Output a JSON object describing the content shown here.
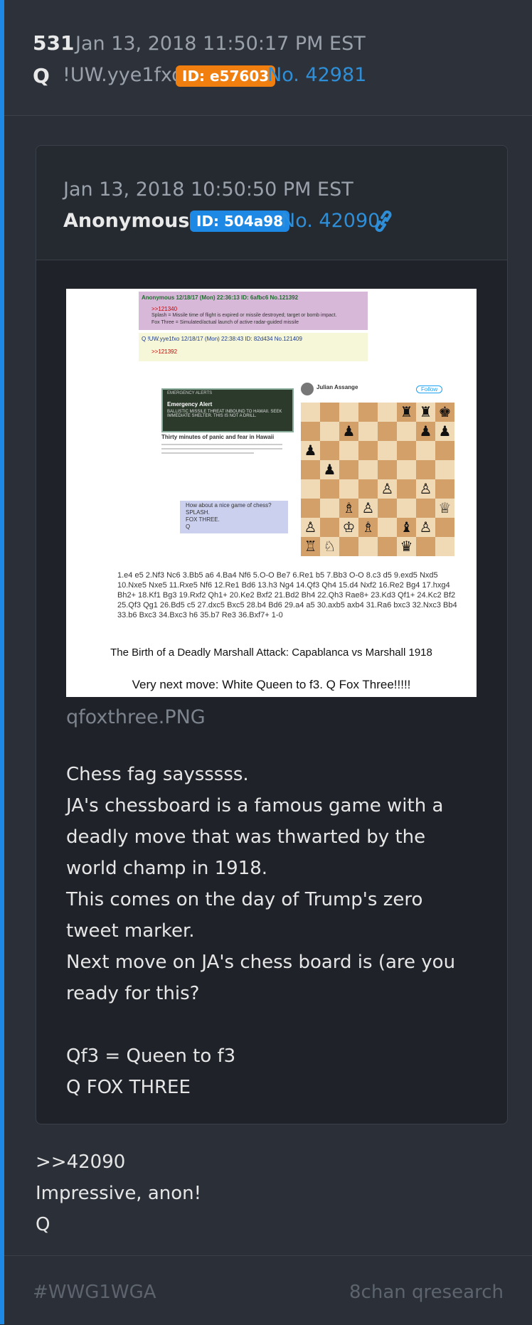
{
  "post": {
    "number": "531",
    "timestamp": "Jan 13, 2018 11:50:17 PM EST",
    "author": "Q",
    "tripcode": "!UW.yye1fxo",
    "id_badge": "ID: e57603",
    "post_no": "No. 42981",
    "reply_lines": [
      ">>42090",
      "Impressive, anon!",
      "Q"
    ]
  },
  "quoted": {
    "timestamp": "Jan 13, 2018 10:50:50 PM EST",
    "author": "Anonymous",
    "id_badge": "ID: 504a98",
    "post_no": "No. 42090",
    "link_icon": "link-icon",
    "image_filename": "qfoxthree.PNG",
    "body_lines": [
      "Chess fag saysssss.",
      "JA's chessboard is a famous game with a deadly move that was thwarted by the world champ in 1918.",
      "This comes on the day of Trump's zero tweet marker.",
      "Next move on JA's chess board is (are you ready for this?",
      "",
      "Qf3 = Queen to f3",
      "Q FOX THREE"
    ]
  },
  "image": {
    "tweet1_header": "Anonymous 12/18/17 (Mon) 22:36:13 ID: 6afbc6 No.121392",
    "tweet1_ref": ">>121340",
    "tweet1_line1": "Splash = Missile time of flight is expired or missile destroyed; target or bomb impact.",
    "tweet1_line2": "Fox Three = Simulated/actual launch of active radar-guided missile",
    "tweet2_header": "Q !UW.yye1fxo 12/18/17 (Mon) 22:38:43 ID: 82d434 No.121409",
    "tweet2_ref": ">>121392",
    "alert_title": "EMERGENCY ALERTS",
    "alert_heading": "Emergency Alert",
    "alert_text": "BALLISTIC MISSILE THREAT INBOUND TO HAWAII. SEEK IMMEDIATE SHELTER. THIS IS NOT A DRILL.",
    "hawaii_title": "Thirty minutes of panic and fear in Hawaii",
    "chess_q_lines": [
      "How about a nice game of chess?",
      "SPLASH.",
      "FOX THREE.",
      "Q"
    ],
    "tw_name": "Julian Assange",
    "tw_follow": "Follow",
    "moves": "1.e4 e5 2.Nf3 Nc6 3.Bb5 a6 4.Ba4 Nf6 5.O-O Be7 6.Re1 b5 7.Bb3 O-O 8.c3 d5 9.exd5 Nxd5 10.Nxe5 Nxe5 11.Rxe5 Nf6 12.Re1 Bd6 13.h3 Ng4 14.Qf3 Qh4 15.d4 Nxf2 16.Re2 Bg4 17.hxg4 Bh2+ 18.Kf1 Bg3 19.Rxf2 Qh1+ 20.Ke2 Bxf2 21.Bd2 Bh4 22.Qh3 Rae8+ 23.Kd3 Qf1+ 24.Kc2 Bf2 25.Qf3 Qg1 26.Bd5 c5 27.dxc5 Bxc5 28.b4 Bd6 29.a4 a5 30.axb5 axb4 31.Ra6 bxc3 32.Nxc3 Bb4 33.b6 Bxc3 34.Bxc3 h6 35.b7 Re3 36.Bxf7+ 1-0",
    "caption": "The Birth of a Deadly Marshall Attack: Capablanca vs Marshall 1918",
    "caption2": "Very next move: White Queen to f3. Q Fox Three!!!!!"
  },
  "footer": {
    "hashtag": "#WWG1WGA",
    "source": "8chan qresearch"
  }
}
